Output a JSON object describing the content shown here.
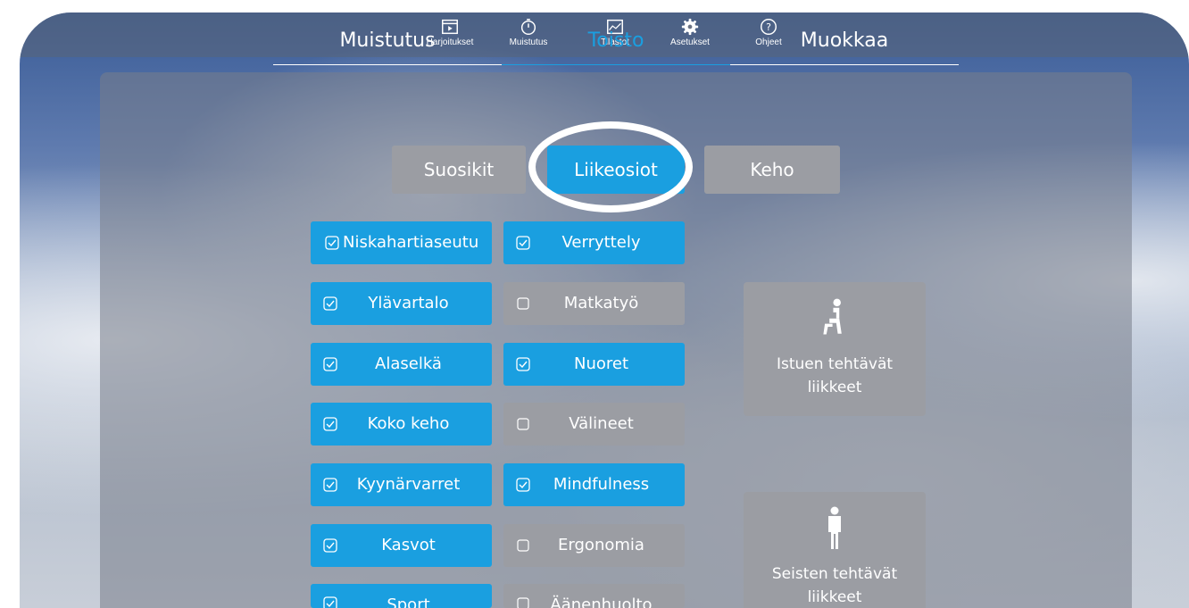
{
  "nav": {
    "items": [
      {
        "label": "Harjoitukset",
        "icon": "play-folder-icon"
      },
      {
        "label": "Muistutus",
        "icon": "stopwatch-icon"
      },
      {
        "label": "Tilastot",
        "icon": "chart-icon"
      },
      {
        "label": "Asetukset",
        "icon": "gear-icon"
      },
      {
        "label": "Ohjeet",
        "icon": "help-icon"
      }
    ]
  },
  "tabs": {
    "items": [
      {
        "label": "Muistutus",
        "active": false
      },
      {
        "label": "Toisto",
        "active": true
      },
      {
        "label": "Muokkaa",
        "active": false
      }
    ],
    "active_color": "#1a9fe0"
  },
  "segments": {
    "items": [
      {
        "label": "Suosikit",
        "active": false
      },
      {
        "label": "Liikeosiot",
        "active": true
      },
      {
        "label": "Keho",
        "active": false
      }
    ]
  },
  "categories": {
    "left": [
      {
        "label": "Niskahartiaseutu",
        "checked": true
      },
      {
        "label": "Ylävartalo",
        "checked": true
      },
      {
        "label": "Alaselkä",
        "checked": true
      },
      {
        "label": "Koko keho",
        "checked": true
      },
      {
        "label": "Kyynärvarret",
        "checked": true
      },
      {
        "label": "Kasvot",
        "checked": true
      },
      {
        "label": "Sport",
        "checked": true
      }
    ],
    "right": [
      {
        "label": "Verryttely",
        "checked": true
      },
      {
        "label": "Matkatyö",
        "checked": false
      },
      {
        "label": "Nuoret",
        "checked": true
      },
      {
        "label": "Välineet",
        "checked": false
      },
      {
        "label": "Mindfulness",
        "checked": true
      },
      {
        "label": "Ergonomia",
        "checked": false
      },
      {
        "label": "Äänenhuolto",
        "checked": false
      }
    ]
  },
  "postures": {
    "sitting": {
      "line1": "Istuen tehtävät",
      "line2": "liikkeet",
      "icon": "sitting-person-icon"
    },
    "standing": {
      "line1": "Seisten tehtävät",
      "line2": "liikkeet",
      "icon": "standing-person-icon"
    }
  },
  "colors": {
    "accent": "#1a9fe0",
    "inactive": "#9b9da3"
  }
}
